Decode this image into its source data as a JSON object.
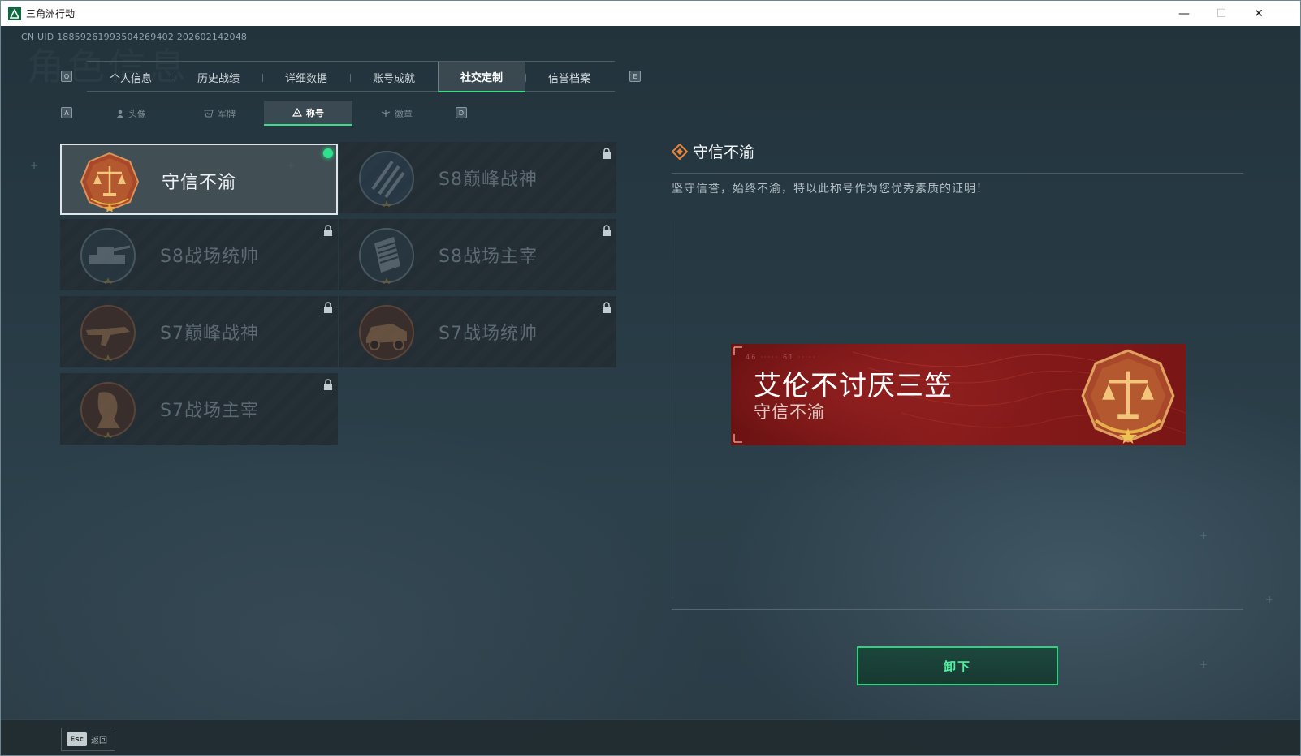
{
  "window": {
    "title": "三角洲行动",
    "minimize": "—",
    "maximize": "☐",
    "close": "✕"
  },
  "header": {
    "uid": "CN UID 1885926199350426940​2 2026021420​48",
    "watermark": "角色信息"
  },
  "keys": {
    "tab_prev": "Q",
    "tab_next": "E",
    "sub_prev": "A",
    "sub_next": "D"
  },
  "tabs": [
    {
      "label": "个人信息"
    },
    {
      "label": "历史战绩"
    },
    {
      "label": "详细数据"
    },
    {
      "label": "账号成就"
    },
    {
      "label": "社交定制"
    },
    {
      "label": "信誉档案"
    }
  ],
  "subtabs": [
    {
      "label": "头像",
      "icon": "person-icon"
    },
    {
      "label": "军牌",
      "icon": "dogtag-icon"
    },
    {
      "label": "称号",
      "icon": "title-icon"
    },
    {
      "label": "徽章",
      "icon": "emblem-icon"
    }
  ],
  "titles": [
    {
      "name": "守信不渝",
      "selected": true,
      "equipped": true,
      "locked": false,
      "badge": "scales-badge"
    },
    {
      "name": "S8巅峰战神",
      "selected": false,
      "equipped": false,
      "locked": true,
      "badge": "stripes-badge"
    },
    {
      "name": "S8战场统帅",
      "selected": false,
      "equipped": false,
      "locked": true,
      "badge": "tank-badge"
    },
    {
      "name": "S8战场主宰",
      "selected": false,
      "equipped": false,
      "locked": true,
      "badge": "building-badge"
    },
    {
      "name": "S7巅峰战神",
      "selected": false,
      "equipped": false,
      "locked": true,
      "badge": "rifle-badge"
    },
    {
      "name": "S7战场统帅",
      "selected": false,
      "equipped": false,
      "locked": true,
      "badge": "vehicle-badge"
    },
    {
      "name": "S7战场主宰",
      "selected": false,
      "equipped": false,
      "locked": true,
      "badge": "operator-badge"
    }
  ],
  "detail": {
    "title": "守信不渝",
    "description": "坚守信誉，始终不渝，特以此称号作为您优秀素质的证明！"
  },
  "banner": {
    "player_name": "艾伦不讨厌三笠",
    "title": "守信不渝",
    "code": "46 ····· 61 ·····"
  },
  "action": {
    "unequip_label": "卸下"
  },
  "footer": {
    "esc_key": "Esc",
    "back_label": "返回"
  },
  "colors": {
    "accent": "#2bd47f",
    "banner_red": "#8a1c1c",
    "badge_copper": "#b4582f",
    "gold": "#e7b04a"
  }
}
